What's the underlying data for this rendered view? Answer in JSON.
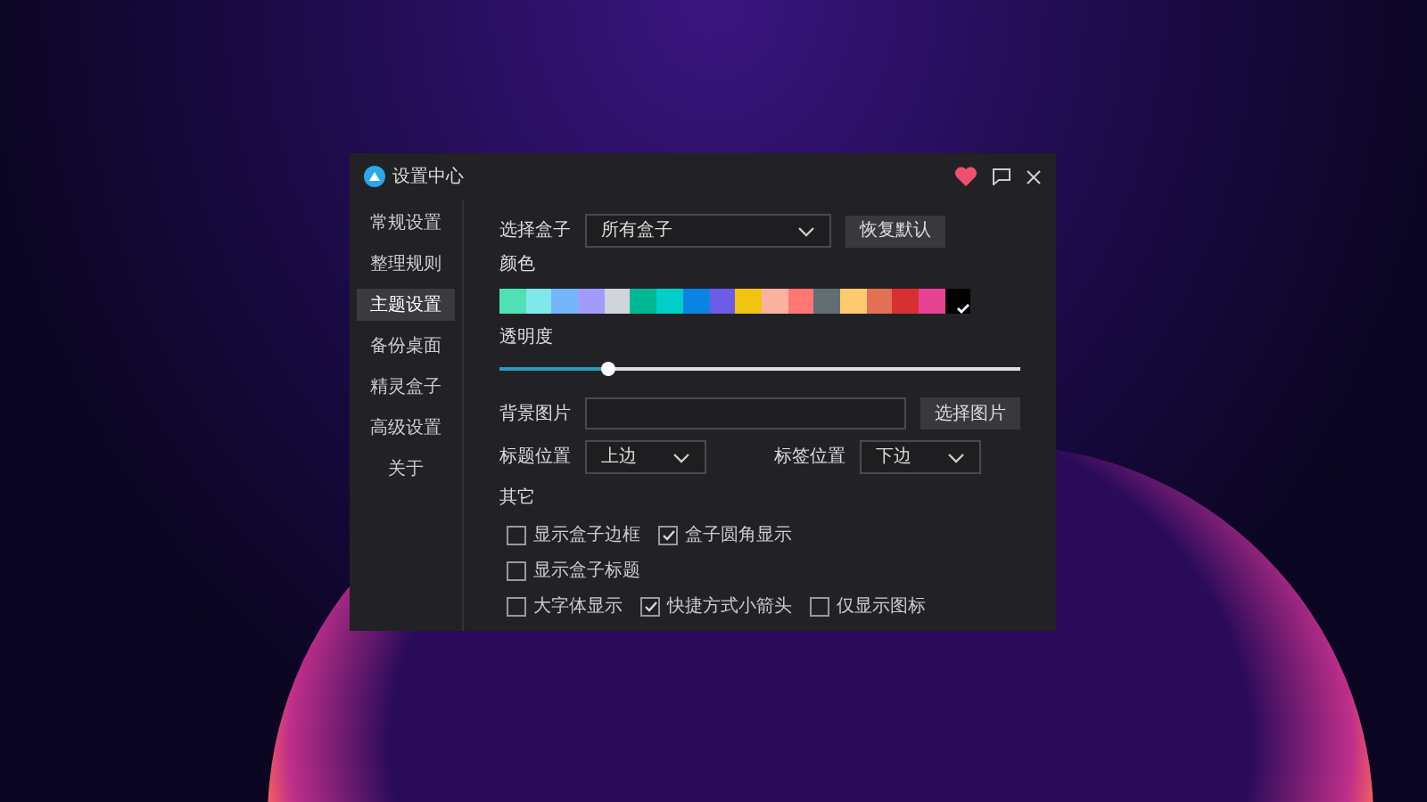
{
  "window": {
    "title": "设置中心"
  },
  "sidebar": {
    "items": [
      {
        "label": "常规设置",
        "selected": false
      },
      {
        "label": "整理规则",
        "selected": false
      },
      {
        "label": "主题设置",
        "selected": true
      },
      {
        "label": "备份桌面",
        "selected": false
      },
      {
        "label": "精灵盒子",
        "selected": false
      },
      {
        "label": "高级设置",
        "selected": false
      },
      {
        "label": "关于",
        "selected": false
      }
    ]
  },
  "box_select": {
    "label": "选择盒子",
    "value": "所有盒子",
    "button": "恢复默认"
  },
  "color": {
    "label": "颜色",
    "swatches": [
      {
        "color": "#4fe0b6",
        "selected": false
      },
      {
        "color": "#80e8e8",
        "selected": false
      },
      {
        "color": "#74b6fb",
        "selected": false
      },
      {
        "color": "#a29bfe",
        "selected": false
      },
      {
        "color": "#d0d5dc",
        "selected": false
      },
      {
        "color": "#00b894",
        "selected": false
      },
      {
        "color": "#00cec9",
        "selected": false
      },
      {
        "color": "#0984e3",
        "selected": false
      },
      {
        "color": "#6c5ce7",
        "selected": false
      },
      {
        "color": "#f1c40f",
        "selected": false
      },
      {
        "color": "#fab1a0",
        "selected": false
      },
      {
        "color": "#ff7675",
        "selected": false
      },
      {
        "color": "#636e72",
        "selected": false
      },
      {
        "color": "#fdcb6e",
        "selected": false
      },
      {
        "color": "#e17055",
        "selected": false
      },
      {
        "color": "#d63031",
        "selected": false
      },
      {
        "color": "#e84393",
        "selected": false
      },
      {
        "color": "#000000",
        "selected": true
      }
    ]
  },
  "opacity": {
    "label": "透明度",
    "level": 0.21
  },
  "background_image": {
    "label": "背景图片",
    "button": "选择图片"
  },
  "title_position": {
    "label": "标题位置",
    "value": "上边"
  },
  "tag_position": {
    "label": "标签位置",
    "value": "下边"
  },
  "other": {
    "label": "其它",
    "rows": [
      [
        {
          "label": "显示盒子边框",
          "checked": false
        },
        {
          "label": "盒子圆角显示",
          "checked": true
        }
      ],
      [
        {
          "label": "显示盒子标题",
          "checked": false
        }
      ],
      [
        {
          "label": "大字体显示",
          "checked": false
        },
        {
          "label": "快捷方式小箭头",
          "checked": true
        },
        {
          "label": "仅显示图标",
          "checked": false
        }
      ]
    ]
  }
}
